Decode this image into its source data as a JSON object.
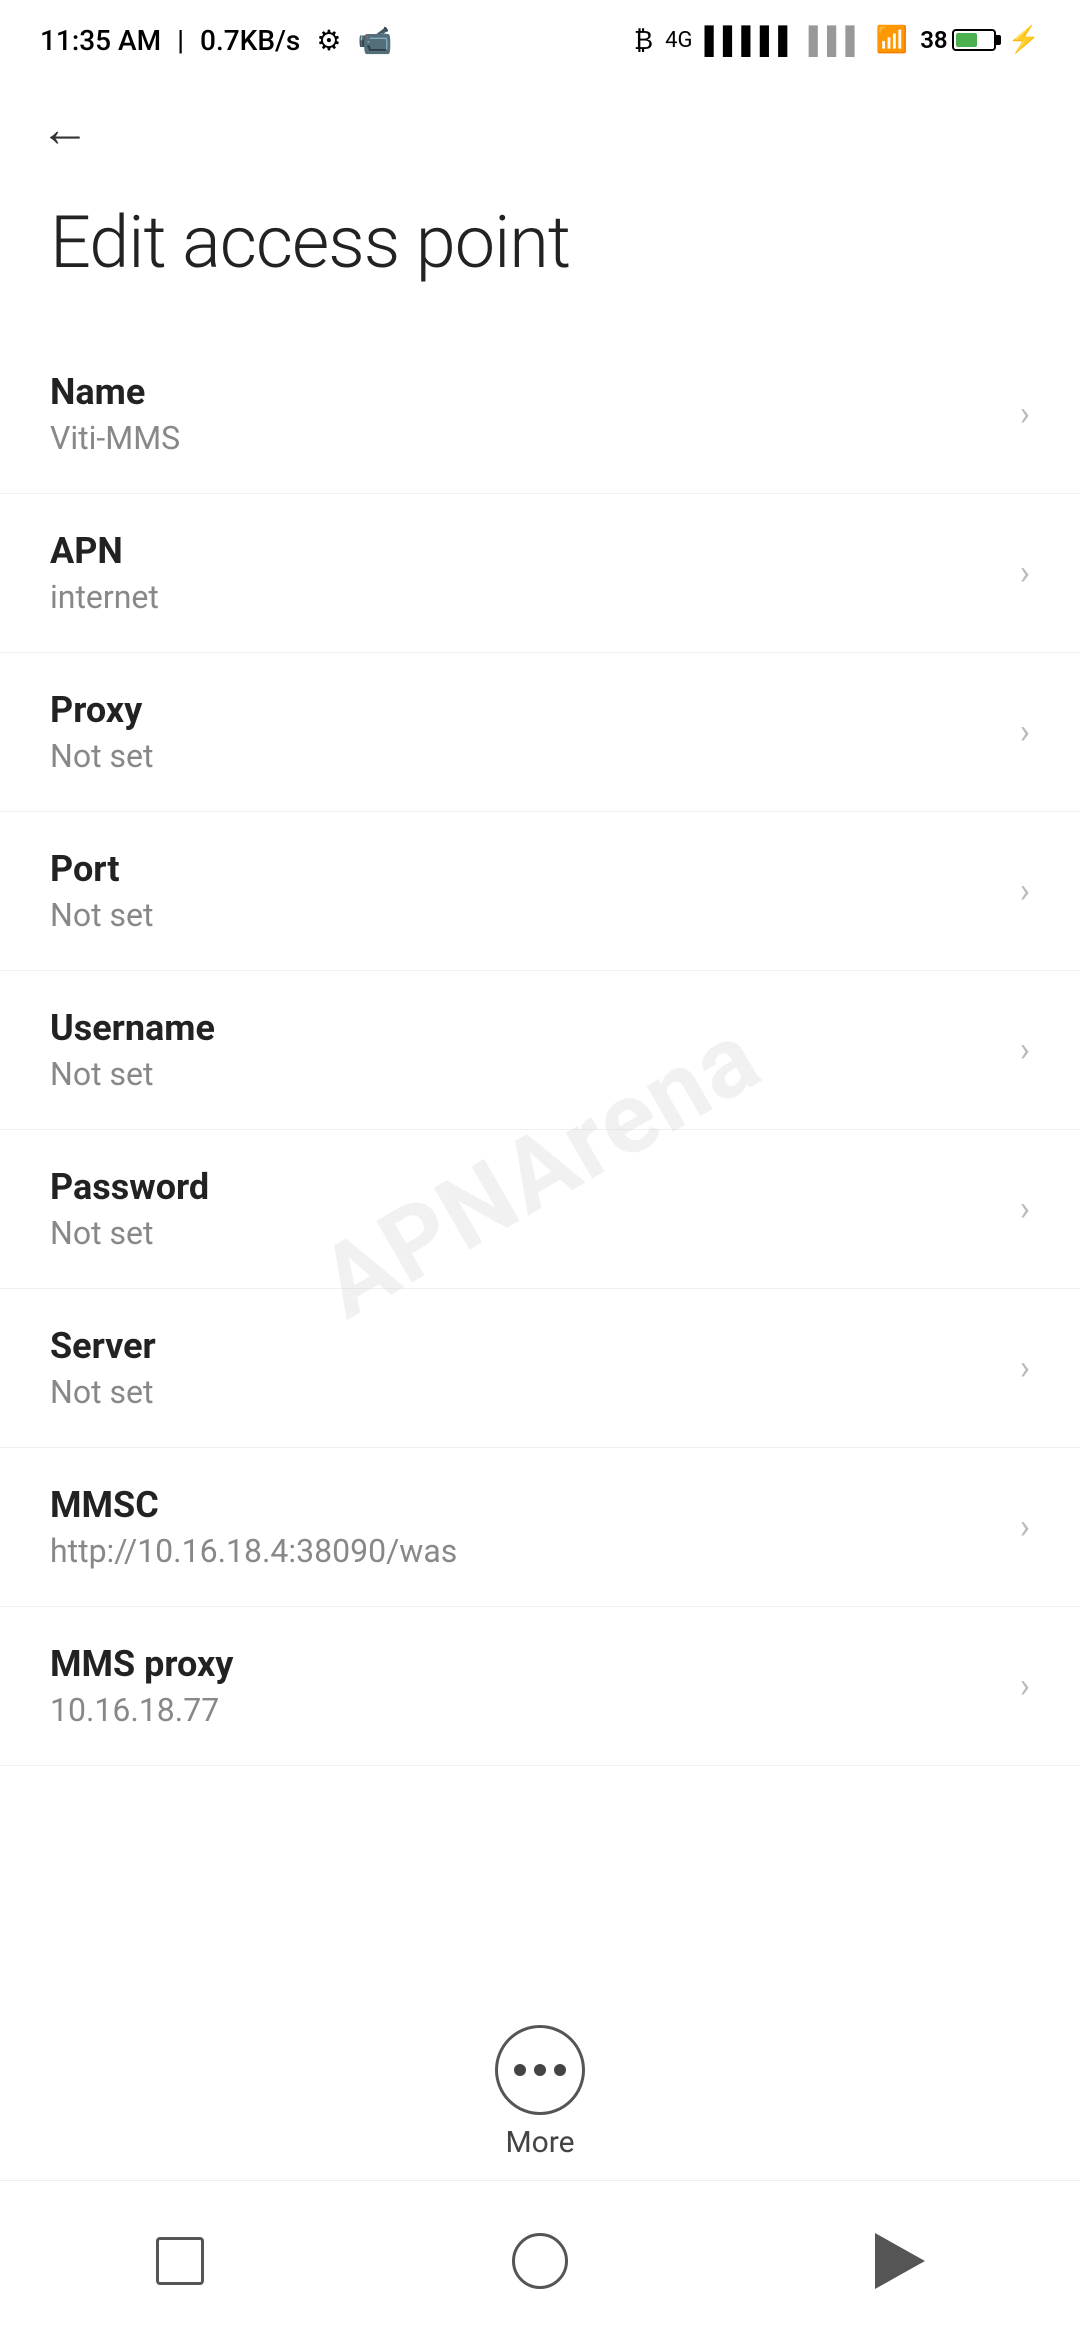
{
  "statusBar": {
    "time": "11:35 AM",
    "speed": "0.7KB/s",
    "battery": 38
  },
  "toolbar": {
    "backLabel": "←"
  },
  "pageTitle": "Edit access point",
  "settingsItems": [
    {
      "label": "Name",
      "value": "Viti-MMS"
    },
    {
      "label": "APN",
      "value": "internet"
    },
    {
      "label": "Proxy",
      "value": "Not set"
    },
    {
      "label": "Port",
      "value": "Not set"
    },
    {
      "label": "Username",
      "value": "Not set"
    },
    {
      "label": "Password",
      "value": "Not set"
    },
    {
      "label": "Server",
      "value": "Not set"
    },
    {
      "label": "MMSC",
      "value": "http://10.16.18.4:38090/was"
    },
    {
      "label": "MMS proxy",
      "value": "10.16.18.77"
    }
  ],
  "moreButton": {
    "label": "More"
  },
  "watermark": {
    "text": "APNArena"
  }
}
